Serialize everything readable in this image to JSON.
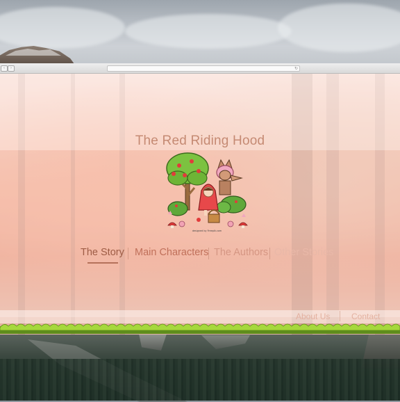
{
  "browser": {
    "nav_back": "‹",
    "nav_fwd": "›",
    "url": "",
    "reload_icon": "↻"
  },
  "page": {
    "title": "The Red Riding Hood",
    "illustration_credit": "designed by Freepik.com",
    "nav": {
      "items": [
        {
          "label": "The Story",
          "active": true
        },
        {
          "label": "Main Characters",
          "active": false
        },
        {
          "label": "The Authors",
          "active": false
        },
        {
          "label": "Other Stories",
          "active": false
        }
      ]
    },
    "footer": {
      "about": "About Us",
      "contact": "Contact"
    }
  },
  "colors": {
    "title": "#c58a73",
    "nav_active": "#9e5c45",
    "nav_main": "#c0705a",
    "nav_authors": "#d59683",
    "nav_other": "#e9b8a8",
    "grass": "#8cbd2a"
  }
}
